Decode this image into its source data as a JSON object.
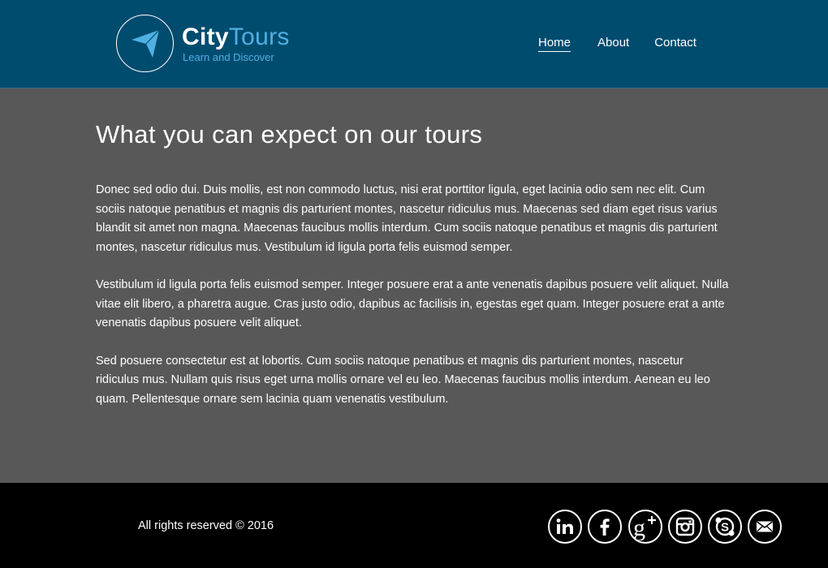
{
  "header": {
    "logo": {
      "title_part1": "City",
      "title_part2": "Tours",
      "tagline": "Learn and Discover",
      "icon": "paper-plane-arrow-icon",
      "accent_color": "#4fb0e3"
    },
    "nav": {
      "items": [
        {
          "label": "Home",
          "active": true
        },
        {
          "label": "About",
          "active": false
        },
        {
          "label": "Contact",
          "active": false
        }
      ]
    },
    "background_color": "#004c6f"
  },
  "main": {
    "heading": "What you can expect on our tours",
    "paragraphs": [
      "Donec sed odio dui. Duis mollis, est non commodo luctus, nisi erat porttitor ligula, eget lacinia odio sem nec elit. Cum sociis natoque penatibus et magnis dis parturient montes, nascetur ridiculus mus. Maecenas sed diam eget risus varius blandit sit amet non magna. Maecenas faucibus mollis interdum. Cum sociis natoque penatibus et magnis dis parturient montes, nascetur ridiculus mus. Vestibulum id ligula porta felis euismod semper.",
      "Vestibulum id ligula porta felis euismod semper. Integer posuere erat a ante venenatis dapibus posuere velit aliquet. Nulla vitae elit libero, a pharetra augue. Cras justo odio, dapibus ac facilisis in, egestas eget quam. Integer posuere erat a ante venenatis dapibus posuere velit aliquet.",
      "Sed posuere consectetur est at lobortis. Cum sociis natoque penatibus et magnis dis parturient montes, nascetur ridiculus mus. Nullam quis risus eget urna mollis ornare vel eu leo. Maecenas faucibus mollis interdum. Aenean eu leo quam. Pellentesque ornare sem lacinia quam venenatis vestibulum."
    ],
    "background_color": "#585858"
  },
  "footer": {
    "copyright": "All rights reserved © 2016",
    "social": [
      {
        "icon": "linkedin-icon"
      },
      {
        "icon": "facebook-icon"
      },
      {
        "icon": "google-plus-icon"
      },
      {
        "icon": "instagram-icon"
      },
      {
        "icon": "skype-icon"
      },
      {
        "icon": "email-icon"
      }
    ],
    "background_color": "#000000"
  }
}
